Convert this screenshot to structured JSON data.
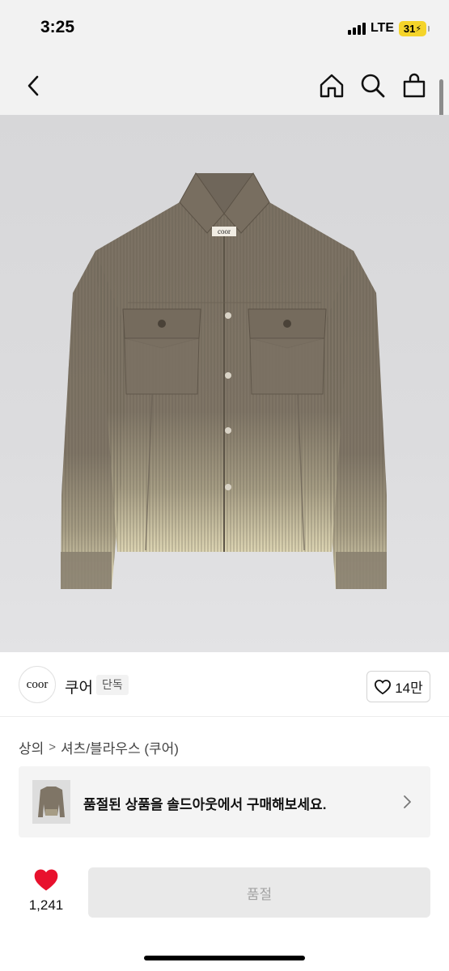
{
  "status_bar": {
    "time": "3:25",
    "network": "LTE",
    "battery": "31"
  },
  "nav": {
    "icons": [
      "chevron-left-icon",
      "home-icon",
      "search-icon",
      "shopping-bag-icon"
    ]
  },
  "product": {
    "image_alt": "brown corduroy shirt jacket",
    "label_text": "coor"
  },
  "brand": {
    "logo_text": "coor",
    "name": "쿠어",
    "badge": "단독",
    "like_count": "14만"
  },
  "breadcrumb": {
    "items": [
      "상의",
      "셔츠/블라우스 (쿠어)"
    ],
    "separator": ">"
  },
  "soldout_banner": {
    "text": "품절된 상품을 솔드아웃에서 구매해보세요."
  },
  "bottom": {
    "wish_count": "1,241",
    "status_button": "품절"
  },
  "colors": {
    "heart": "#e8112d",
    "jacket": "#7d7264",
    "background_gray": "#dcdcde"
  }
}
